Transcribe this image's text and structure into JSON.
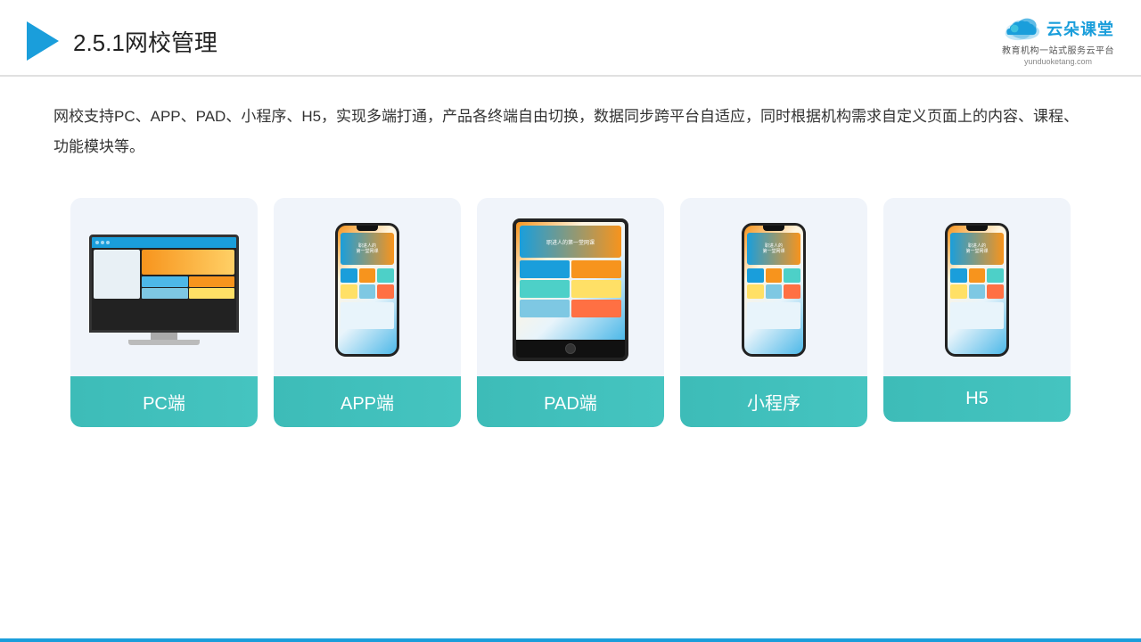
{
  "header": {
    "title_prefix": "2.5.1",
    "title_main": "网校管理",
    "logo_main": "云朵课堂",
    "logo_url": "yunduoketang.com",
    "logo_tagline": "教育机构一站式服务云平台"
  },
  "description": {
    "text": "网校支持PC、APP、PAD、小程序、H5，实现多端打通，产品各终端自由切换，数据同步跨平台自适应，同时根据机构需求自定义页面上的内容、课程、功能模块等。"
  },
  "cards": [
    {
      "id": "pc",
      "label": "PC端"
    },
    {
      "id": "app",
      "label": "APP端"
    },
    {
      "id": "pad",
      "label": "PAD端"
    },
    {
      "id": "miniprogram",
      "label": "小程序"
    },
    {
      "id": "h5",
      "label": "H5"
    }
  ]
}
